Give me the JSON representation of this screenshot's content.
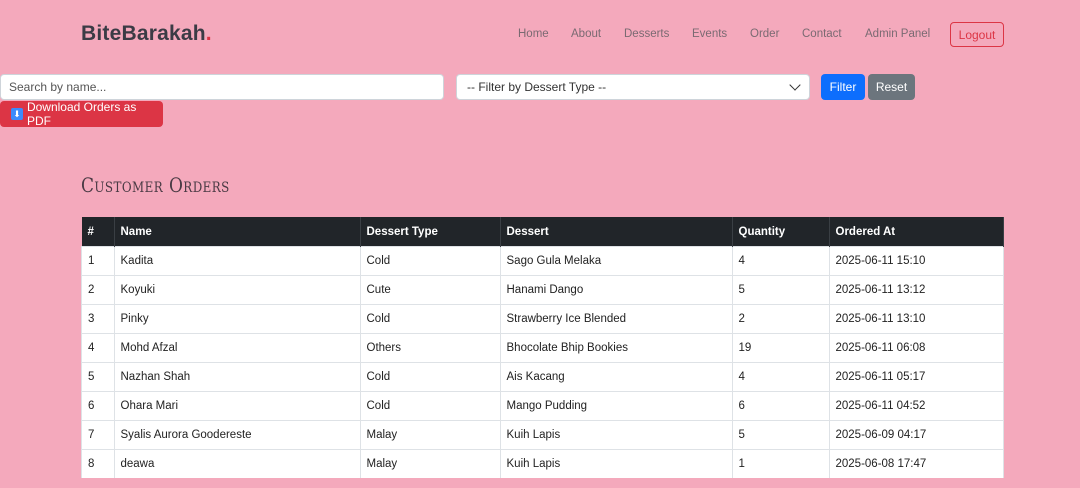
{
  "brand": {
    "name": "BiteBarakah",
    "dot": "."
  },
  "nav": {
    "items": [
      "Home",
      "About",
      "Desserts",
      "Events",
      "Order",
      "Contact",
      "Admin Panel"
    ],
    "logout": "Logout"
  },
  "filters": {
    "search_placeholder": "Search by name...",
    "dessert_type_selected": "-- Filter by Dessert Type --",
    "filter_label": "Filter",
    "reset_label": "Reset",
    "pdf_label": "Download Orders as PDF",
    "pdf_icon": "down-arrow-icon"
  },
  "page": {
    "title": "Customer Orders"
  },
  "table": {
    "headers": [
      "#",
      "Name",
      "Dessert Type",
      "Dessert",
      "Quantity",
      "Ordered At"
    ],
    "rows": [
      [
        "1",
        "Kadita",
        "Cold",
        "Sago Gula Melaka",
        "4",
        "2025-06-11 15:10"
      ],
      [
        "2",
        "Koyuki",
        "Cute",
        "Hanami Dango",
        "5",
        "2025-06-11 13:12"
      ],
      [
        "3",
        "Pinky",
        "Cold",
        "Strawberry Ice Blended",
        "2",
        "2025-06-11 13:10"
      ],
      [
        "4",
        "Mohd Afzal",
        "Others",
        "Bhocolate Bhip Bookies",
        "19",
        "2025-06-11 06:08"
      ],
      [
        "5",
        "Nazhan Shah",
        "Cold",
        "Ais Kacang",
        "4",
        "2025-06-11 05:17"
      ],
      [
        "6",
        "Ohara Mari",
        "Cold",
        "Mango Pudding",
        "6",
        "2025-06-11 04:52"
      ],
      [
        "7",
        "Syalis Aurora Goodereste",
        "Malay",
        "Kuih Lapis",
        "5",
        "2025-06-09 04:17"
      ],
      [
        "8",
        "deawa",
        "Malay",
        "Kuih Lapis",
        "1",
        "2025-06-08 17:47"
      ]
    ]
  }
}
